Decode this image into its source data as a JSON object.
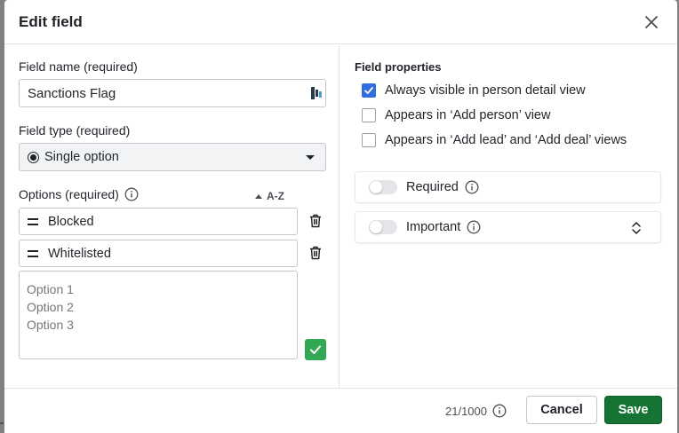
{
  "dialog": {
    "title": "Edit field"
  },
  "field_name": {
    "label": "Field name (required)",
    "value": "Sanctions Flag"
  },
  "field_type": {
    "label": "Field type (required)",
    "selected": "Single option"
  },
  "options": {
    "label": "Options (required)",
    "sort_label": "A-Z",
    "items": [
      {
        "label": "Blocked"
      },
      {
        "label": "Whitelisted"
      }
    ],
    "placeholder": "Option 1\nOption 2\nOption 3"
  },
  "properties": {
    "heading": "Field properties",
    "checkboxes": [
      {
        "label": "Always visible in person detail view",
        "checked": true
      },
      {
        "label": "Appears in ‘Add person’ view",
        "checked": false
      },
      {
        "label": "Appears in ‘Add lead’ and ‘Add deal’ views",
        "checked": false
      }
    ],
    "toggles": [
      {
        "label": "Required",
        "on": false
      },
      {
        "label": "Important",
        "on": false
      }
    ]
  },
  "footer": {
    "counter": "21/1000",
    "cancel_label": "Cancel",
    "save_label": "Save"
  },
  "colors": {
    "save": "#157333",
    "checkbox_checked": "#2f6fe0",
    "confirm": "#33a852"
  }
}
